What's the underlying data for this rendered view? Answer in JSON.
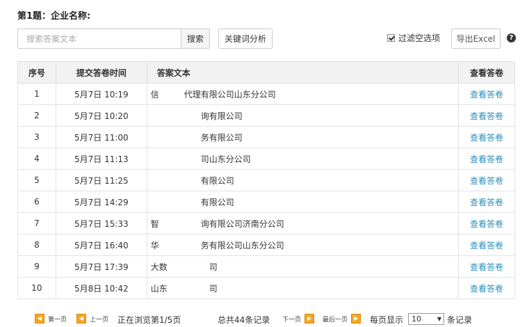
{
  "question": {
    "title": "第1题：企业名称:"
  },
  "search": {
    "placeholder": "搜索答案文本",
    "button_label": "搜索"
  },
  "keyword_button_label": "关键词分析",
  "filter": {
    "label": "过滤空选项",
    "checked": true
  },
  "export_button_label": "导出Excel",
  "help_icon": "?",
  "table": {
    "headers": {
      "index": "序号",
      "time": "提交答卷时间",
      "text": "答案文本",
      "view": "查看答卷"
    },
    "rows": [
      {
        "index": "1",
        "time": "5月7日 10:19",
        "text": "信　　　代理有限公司山东分公司",
        "view": "查看答卷"
      },
      {
        "index": "2",
        "time": "5月7日 10:20",
        "text": "　　　　　　询有限公司",
        "view": "查看答卷"
      },
      {
        "index": "3",
        "time": "5月7日 11:00",
        "text": "　　　　　　务有限公司",
        "view": "查看答卷"
      },
      {
        "index": "4",
        "time": "5月7日 11:13",
        "text": "　　　　　　司山东分公司",
        "view": "查看答卷"
      },
      {
        "index": "5",
        "time": "5月7日 11:25",
        "text": "　　　　　　有限公司",
        "view": "查看答卷"
      },
      {
        "index": "6",
        "time": "5月7日 14:29",
        "text": "　　　　　　有限公司",
        "view": "查看答卷"
      },
      {
        "index": "7",
        "time": "5月7日 15:33",
        "text": "智　　　　　询有限公司济南分公司",
        "view": "查看答卷"
      },
      {
        "index": "8",
        "time": "5月7日 16:40",
        "text": "华　　　　　务有限公司山东分公司",
        "view": "查看答卷"
      },
      {
        "index": "9",
        "time": "5月7日 17:39",
        "text": "大数　　　　　司",
        "view": "查看答卷"
      },
      {
        "index": "10",
        "time": "5月8日 10:42",
        "text": "山东　　　　　司",
        "view": "查看答卷"
      }
    ]
  },
  "pager": {
    "first": "第一页",
    "prev": "上一页",
    "status": "正在浏览第1/5页",
    "total": "总共44条记录",
    "next": "下一页",
    "last": "最后一页",
    "per_page_label": "每页显示",
    "per_page_value": "10",
    "records_suffix": "条记录"
  },
  "colors": {
    "link": "#2a8fbd",
    "pager_icon": "#f5a623",
    "header_bg": "#f2f2f2"
  }
}
